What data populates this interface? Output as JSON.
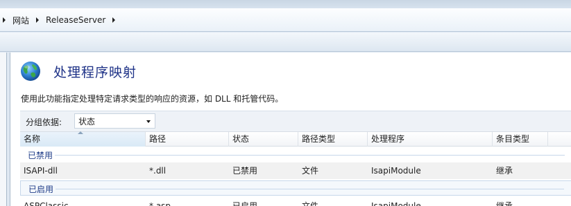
{
  "breadcrumb": {
    "items": [
      "网站",
      "ReleaseServer"
    ]
  },
  "header": {
    "title": "处理程序映射",
    "description": "使用此功能指定处理特定请求类型的响应的资源，如 DLL 和托管代码。"
  },
  "group_by": {
    "label": "分组依据:",
    "value": "状态"
  },
  "table": {
    "columns": [
      "名称",
      "路径",
      "状态",
      "路径类型",
      "处理程序",
      "条目类型"
    ],
    "groups": [
      {
        "label": "已禁用",
        "rows": [
          {
            "name": "ISAPI-dll",
            "path": "*.dll",
            "state": "已禁用",
            "path_type": "文件",
            "handler": "IsapiModule",
            "entry_type": "继承"
          }
        ]
      },
      {
        "label": "已启用",
        "rows": [
          {
            "name": "ASPClassic",
            "path": "*.asp",
            "state": "已启用",
            "path_type": "文件",
            "handler": "IsapiModule",
            "entry_type": "继承"
          }
        ]
      }
    ]
  },
  "colors": {
    "title": "#1e3287",
    "group_label": "#1f3c88",
    "background": "#dfe8f2"
  },
  "icons": {
    "page_icon": "globe-icon",
    "group_caret": "chevron-down-icon",
    "sort_indicator": "sort-ascending-icon"
  }
}
